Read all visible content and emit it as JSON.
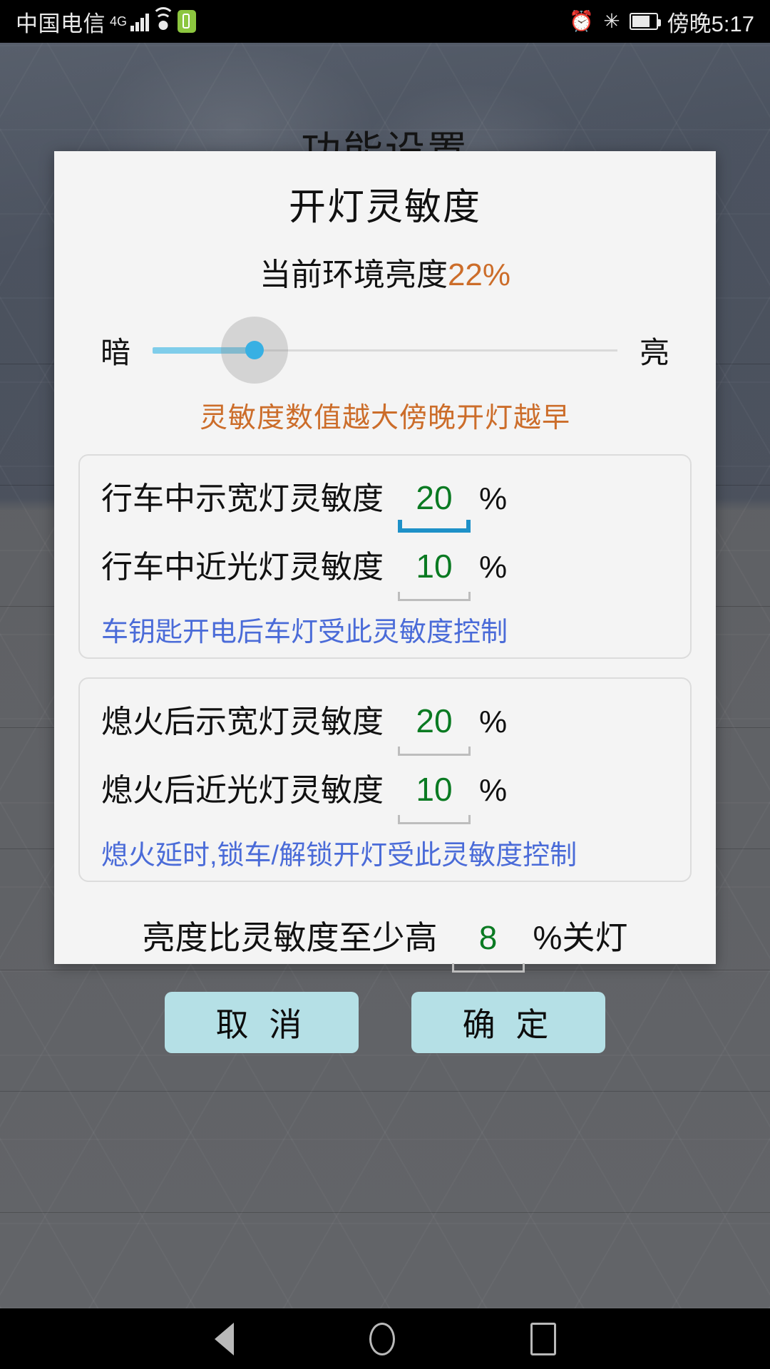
{
  "status_bar": {
    "carrier": "中国电信",
    "network_type": "4G",
    "signal_icon": "signal-bars-icon",
    "wifi_icon": "wifi-icon",
    "charging_badge_icon": "charging-battery-badge-icon",
    "alarm_icon": "⏰",
    "bluetooth_icon": "✳",
    "battery_icon": "battery-icon",
    "clock": "傍晚5:17"
  },
  "background": {
    "page_title": "功能设置"
  },
  "dialog": {
    "title": "开灯灵敏度",
    "ambient": {
      "label": "当前环境亮度",
      "value": "22%"
    },
    "slider": {
      "left_label": "暗",
      "right_label": "亮",
      "position_percent": 22,
      "fill_color": "#7fcdea",
      "thumb_color": "#38b0e3"
    },
    "hint_orange": "灵敏度数值越大傍晚开灯越早",
    "groups": [
      {
        "rows": [
          {
            "label": "行车中示宽灯灵敏度",
            "value": "20",
            "unit": "%",
            "focused": true
          },
          {
            "label": "行车中近光灯灵敏度",
            "value": "10",
            "unit": "%",
            "focused": false
          }
        ],
        "hint": "车钥匙开电后车灯受此灵敏度控制"
      },
      {
        "rows": [
          {
            "label": "熄火后示宽灯灵敏度",
            "value": "20",
            "unit": "%",
            "focused": false
          },
          {
            "label": "熄火后近光灯灵敏度",
            "value": "10",
            "unit": "%",
            "focused": false
          }
        ],
        "hint": "熄火延时,锁车/解锁开灯受此灵敏度控制"
      }
    ],
    "off_threshold": {
      "label": "亮度比灵敏度至少高",
      "value": "8",
      "suffix": "%关灯"
    },
    "buttons": {
      "cancel": "取 消",
      "confirm": "确 定"
    },
    "colors": {
      "value_green": "#0a7a22",
      "hint_orange": "#cc6d2a",
      "hint_blue": "#4a6bd8",
      "button_bg": "#b5e0e6",
      "focus_underline": "#1e91c8"
    }
  },
  "nav_bar": {
    "back": "back-triangle-icon",
    "home": "home-circle-icon",
    "recents": "recents-square-icon"
  }
}
